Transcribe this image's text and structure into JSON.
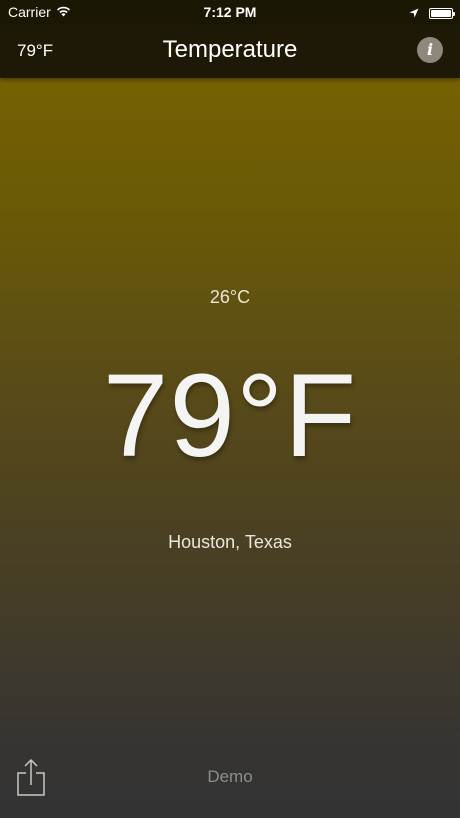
{
  "status_bar": {
    "carrier": "Carrier",
    "time": "7:12 PM"
  },
  "nav": {
    "left_value": "79°F",
    "title": "Temperature"
  },
  "main": {
    "celsius": "26°C",
    "fahrenheit": "79°F",
    "location": "Houston, Texas"
  },
  "bottom": {
    "demo_label": "Demo"
  },
  "icons": {
    "wifi": "wifi-icon",
    "location": "location-arrow-icon",
    "battery": "battery-icon",
    "info": "info-icon",
    "share": "share-icon"
  },
  "colors": {
    "background_top": "#7a6600",
    "background_bottom": "#333333",
    "nav_background": "#1d1906",
    "info_button": "#8d877c"
  }
}
